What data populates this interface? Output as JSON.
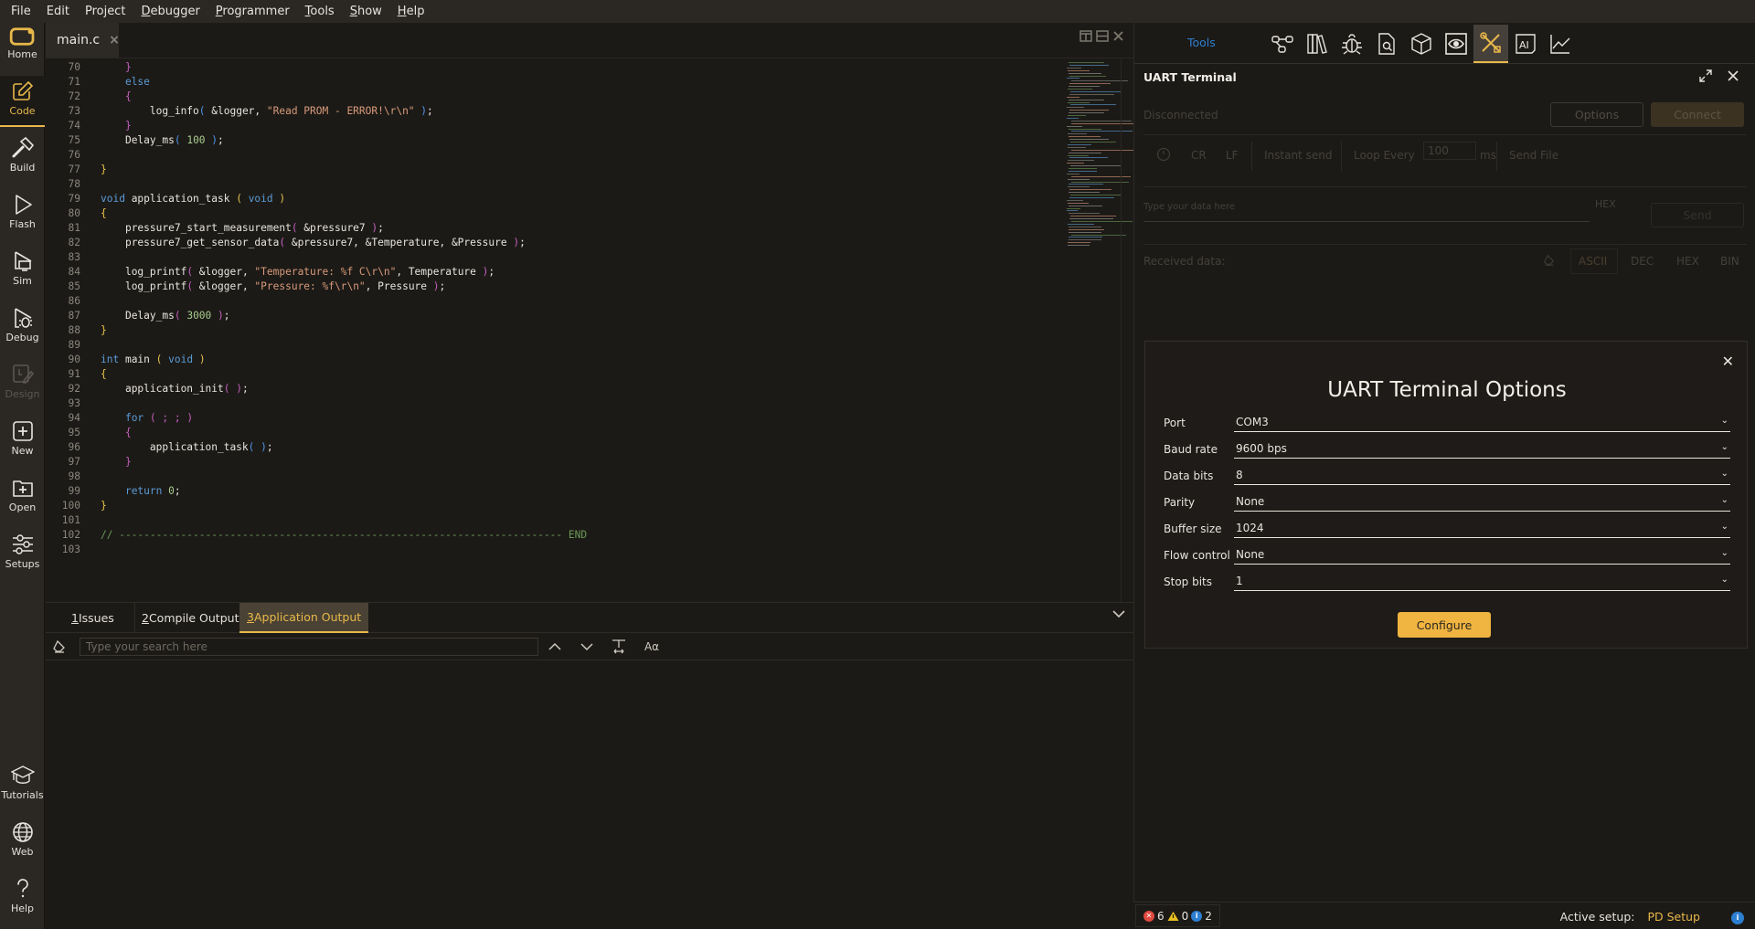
{
  "menu": [
    {
      "label": "File",
      "accel": ""
    },
    {
      "label": "Edit",
      "accel": ""
    },
    {
      "label": "Project",
      "accel": ""
    },
    {
      "label": "Debugger",
      "accel": "D"
    },
    {
      "label": "Programmer",
      "accel": "P"
    },
    {
      "label": "Tools",
      "accel": "T"
    },
    {
      "label": "Show",
      "accel": "S"
    },
    {
      "label": "Help",
      "accel": "H"
    }
  ],
  "sidebar": {
    "items": [
      {
        "label": "Home",
        "icon": "home-logo-icon"
      },
      {
        "label": "Code",
        "icon": "edit-icon",
        "active": true
      },
      {
        "label": "Build",
        "icon": "hammer-icon"
      },
      {
        "label": "Flash",
        "icon": "play-icon"
      },
      {
        "label": "Sim",
        "icon": "sim-icon"
      },
      {
        "label": "Debug",
        "icon": "bug-icon"
      },
      {
        "label": "Design",
        "icon": "design-icon",
        "disabled": true
      },
      {
        "label": "New",
        "icon": "plus-square-icon"
      },
      {
        "label": "Open",
        "icon": "folder-plus-icon"
      },
      {
        "label": "Setups",
        "icon": "sliders-icon"
      },
      {
        "label": "Tutorials",
        "icon": "graduation-cap-icon"
      },
      {
        "label": "Web",
        "icon": "globe-icon"
      },
      {
        "label": "Help",
        "icon": "question-icon"
      }
    ]
  },
  "editor": {
    "file_tab": "main.c",
    "close_glyph": "×",
    "lines": [
      {
        "n": "70",
        "tokens": [
          [
            "",
            "    "
          ],
          [
            "p2",
            "}"
          ]
        ]
      },
      {
        "n": "71",
        "tokens": [
          [
            "",
            "    "
          ],
          [
            "kw",
            "else"
          ]
        ]
      },
      {
        "n": "72",
        "tokens": [
          [
            "",
            "    "
          ],
          [
            "p2",
            "{"
          ]
        ]
      },
      {
        "n": "73",
        "tokens": [
          [
            "",
            "        "
          ],
          [
            "fn",
            "log_info"
          ],
          [
            "p3",
            "("
          ],
          [
            "id",
            " &logger, "
          ],
          [
            "str",
            "\"Read PROM - ERROR!\\r\\n\""
          ],
          [
            "p3",
            " )"
          ],
          [
            "id",
            ";"
          ]
        ]
      },
      {
        "n": "74",
        "tokens": [
          [
            "",
            "    "
          ],
          [
            "p2",
            "}"
          ]
        ]
      },
      {
        "n": "75",
        "tokens": [
          [
            "",
            "    "
          ],
          [
            "fn",
            "Delay_ms"
          ],
          [
            "p3",
            "("
          ],
          [
            "num",
            " 100"
          ],
          [
            "p3",
            " )"
          ],
          [
            "id",
            ";"
          ]
        ]
      },
      {
        "n": "76",
        "tokens": []
      },
      {
        "n": "77",
        "tokens": [
          [
            "p1",
            "}"
          ]
        ]
      },
      {
        "n": "78",
        "tokens": []
      },
      {
        "n": "79",
        "tokens": [
          [
            "kw",
            "void"
          ],
          [
            "fn",
            " application_task "
          ],
          [
            "p1",
            "("
          ],
          [
            "kw",
            " void"
          ],
          [
            "p1",
            " )"
          ]
        ]
      },
      {
        "n": "80",
        "tokens": [
          [
            "p1",
            "{"
          ]
        ]
      },
      {
        "n": "81",
        "tokens": [
          [
            "",
            "    "
          ],
          [
            "fn",
            "pressure7_start_measurement"
          ],
          [
            "p2",
            "("
          ],
          [
            "id",
            " &pressure7 "
          ],
          [
            "p2",
            ")"
          ],
          [
            "id",
            ";"
          ]
        ]
      },
      {
        "n": "82",
        "tokens": [
          [
            "",
            "    "
          ],
          [
            "fn",
            "pressure7_get_sensor_data"
          ],
          [
            "p2",
            "("
          ],
          [
            "id",
            " &pressure7, &Temperature, &Pressure "
          ],
          [
            "p2",
            ")"
          ],
          [
            "id",
            ";"
          ]
        ]
      },
      {
        "n": "83",
        "tokens": []
      },
      {
        "n": "84",
        "tokens": [
          [
            "",
            "    "
          ],
          [
            "fn",
            "log_printf"
          ],
          [
            "p2",
            "("
          ],
          [
            "id",
            " &logger, "
          ],
          [
            "str",
            "\"Temperature: %f C\\r\\n\""
          ],
          [
            "id",
            ", Temperature "
          ],
          [
            "p2",
            ")"
          ],
          [
            "id",
            ";"
          ]
        ]
      },
      {
        "n": "85",
        "tokens": [
          [
            "",
            "    "
          ],
          [
            "fn",
            "log_printf"
          ],
          [
            "p2",
            "("
          ],
          [
            "id",
            " &logger, "
          ],
          [
            "str",
            "\"Pressure: %f\\r\\n\""
          ],
          [
            "id",
            ", Pressure "
          ],
          [
            "p2",
            ")"
          ],
          [
            "id",
            ";"
          ]
        ]
      },
      {
        "n": "86",
        "tokens": []
      },
      {
        "n": "87",
        "tokens": [
          [
            "",
            "    "
          ],
          [
            "fn",
            "Delay_ms"
          ],
          [
            "p2",
            "("
          ],
          [
            "num",
            " 3000"
          ],
          [
            "p2",
            " )"
          ],
          [
            "id",
            ";"
          ]
        ]
      },
      {
        "n": "88",
        "tokens": [
          [
            "p1",
            "}"
          ]
        ]
      },
      {
        "n": "89",
        "tokens": []
      },
      {
        "n": "90",
        "tokens": [
          [
            "kw",
            "int"
          ],
          [
            "fn",
            " main "
          ],
          [
            "p1",
            "("
          ],
          [
            "kw",
            " void"
          ],
          [
            "p1",
            " )"
          ]
        ]
      },
      {
        "n": "91",
        "tokens": [
          [
            "p1",
            "{"
          ]
        ]
      },
      {
        "n": "92",
        "tokens": [
          [
            "",
            "    "
          ],
          [
            "fn",
            "application_init"
          ],
          [
            "p2",
            "("
          ],
          [
            "p2",
            " )"
          ],
          [
            "id",
            ";"
          ]
        ]
      },
      {
        "n": "93",
        "tokens": []
      },
      {
        "n": "94",
        "tokens": [
          [
            "",
            "    "
          ],
          [
            "kw",
            "for"
          ],
          [
            "p2",
            " ( ; ; )"
          ]
        ]
      },
      {
        "n": "95",
        "tokens": [
          [
            "",
            "    "
          ],
          [
            "p2",
            "{"
          ]
        ]
      },
      {
        "n": "96",
        "tokens": [
          [
            "",
            "        "
          ],
          [
            "fn",
            "application_task"
          ],
          [
            "p3",
            "("
          ],
          [
            "p3",
            " )"
          ],
          [
            "id",
            ";"
          ]
        ]
      },
      {
        "n": "97",
        "tokens": [
          [
            "",
            "    "
          ],
          [
            "p2",
            "}"
          ]
        ]
      },
      {
        "n": "98",
        "tokens": []
      },
      {
        "n": "99",
        "tokens": [
          [
            "",
            "    "
          ],
          [
            "kw",
            "return"
          ],
          [
            "num",
            " 0"
          ],
          [
            "id",
            ";"
          ]
        ]
      },
      {
        "n": "100",
        "tokens": [
          [
            "p1",
            "}"
          ]
        ]
      },
      {
        "n": "101",
        "tokens": []
      },
      {
        "n": "102",
        "tokens": [
          [
            "cm",
            "// ------------------------------------------------------------------------ END"
          ]
        ]
      },
      {
        "n": "103",
        "tokens": []
      }
    ]
  },
  "bottom_panel": {
    "tabs": [
      {
        "num": "1",
        "label": " Issues"
      },
      {
        "num": "2",
        "label": " Compile Output"
      },
      {
        "num": "3",
        "label": " Application Output",
        "active": true
      }
    ],
    "search_placeholder": "Type your search here",
    "search_value": ""
  },
  "right_panel": {
    "tools_label": "Tools",
    "tool_icons": [
      "network-icon",
      "library-icon",
      "bug-icon",
      "file-search-icon",
      "cube-icon",
      "eye-icon",
      "tools-icon",
      "ai-icon",
      "chart-icon"
    ],
    "active_tool": "tools-icon",
    "uart_title": "UART Terminal",
    "status": "Disconnected",
    "options_btn": "Options",
    "connect_btn": "Connect",
    "toolbar": {
      "cr": "CR",
      "lf": "LF",
      "instant_send": "Instant send",
      "loop_every": "Loop Every",
      "loop_value": "100",
      "ms": "ms",
      "send_file": "Send File"
    },
    "send_placeholder": "Type your data here",
    "hex_label": "HEX",
    "send_btn": "Send",
    "received_label": "Received data:",
    "formats": [
      "ASCII",
      "DEC",
      "HEX",
      "BIN"
    ],
    "active_format": "ASCII"
  },
  "dialog": {
    "title": "UART Terminal Options",
    "close_glyph": "✕",
    "options": [
      {
        "label": "Port",
        "value": "COM3"
      },
      {
        "label": "Baud rate",
        "value": "9600 bps"
      },
      {
        "label": "Data bits",
        "value": "8"
      },
      {
        "label": "Parity",
        "value": "None"
      },
      {
        "label": "Buffer size",
        "value": "1024"
      },
      {
        "label": "Flow control",
        "value": "None"
      },
      {
        "label": "Stop bits",
        "value": "1"
      }
    ],
    "configure_btn": "Configure"
  },
  "statusbar": {
    "errors": "6",
    "warnings": "0",
    "infos": "2",
    "active_setup_label": "Active setup:",
    "active_setup_value": "PD Setup"
  },
  "colors": {
    "accent": "#e8b84a",
    "link": "#2d7fd0",
    "error": "#e04a3f",
    "warning": "#e8c020",
    "info": "#2d7fd0"
  }
}
